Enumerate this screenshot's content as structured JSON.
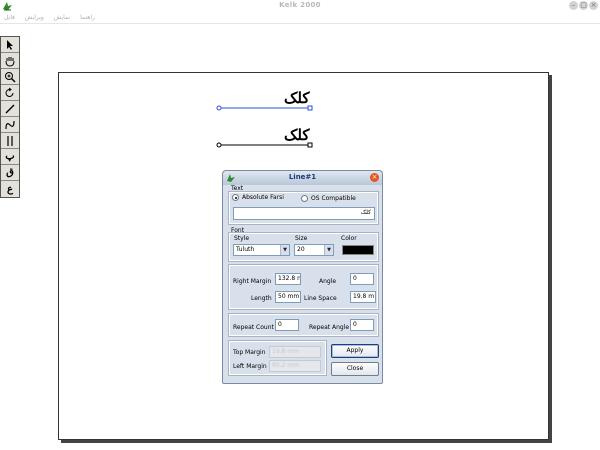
{
  "window": {
    "title": "Kelk 2000",
    "controls": [
      "–",
      "□",
      "×"
    ]
  },
  "menu": [
    {
      "label": "فایل"
    },
    {
      "label": "ویرایش"
    },
    {
      "label": "نمایش"
    },
    {
      "label": "راهنما"
    }
  ],
  "toolbar": [
    {
      "icon": "arrow-select-icon",
      "glyph": ""
    },
    {
      "icon": "hand-pan-icon",
      "glyph": ""
    },
    {
      "icon": "zoom-icon",
      "glyph": ""
    },
    {
      "icon": "rotate-icon",
      "glyph": ""
    },
    {
      "icon": "pen-line-icon",
      "glyph": ""
    },
    {
      "icon": "curve-tool-icon",
      "glyph": ""
    },
    {
      "icon": "parallel-lines-icon",
      "glyph": ""
    },
    {
      "icon": "letter-sample-1-icon",
      "glyph": "پ"
    },
    {
      "icon": "letter-sample-2-icon",
      "glyph": "ق"
    },
    {
      "icon": "letter-sample-3-icon",
      "glyph": "ع"
    }
  ],
  "canvas": {
    "text_line_1": "کلک",
    "text_line_2": "کلک"
  },
  "dialog": {
    "title": "Line#1",
    "text_group_label": "Text",
    "radio_absolute_farsi": "Absolute Farsi",
    "radio_absolute_farsi_checked": true,
    "radio_os_compatible": "OS Compatible",
    "radio_os_compatible_checked": false,
    "text_value": "کلک",
    "font_group_label": "Font",
    "style_label": "Style",
    "style_value": "Tuluth",
    "size_label": "Size",
    "size_value": "20",
    "color_label": "Color",
    "color_value": "#000000",
    "right_margin_label": "Right Margin",
    "right_margin_value": "132.8 n",
    "angle_label": "Angle",
    "angle_value": "0",
    "length_label": "Length",
    "length_value": "50 mm",
    "line_space_label": "Line Space",
    "line_space_value": "19.8 m",
    "repeat_count_label": "Repeat Count",
    "repeat_count_value": "0",
    "repeat_angle_label": "Repeat Angle",
    "repeat_angle_value": "0",
    "top_margin_label": "Top Margin",
    "top_margin_value": "19.8 mm",
    "left_margin_label": "Left Margin",
    "left_margin_value": "90.2 mm",
    "apply_button": "Apply",
    "close_button": "Close"
  },
  "colors": {
    "selection_line": "#2a4fd6",
    "dialog_bg": "#d8e1eb",
    "dialog_title_text": "#1b3b7a",
    "close_button": "#e2571e"
  }
}
